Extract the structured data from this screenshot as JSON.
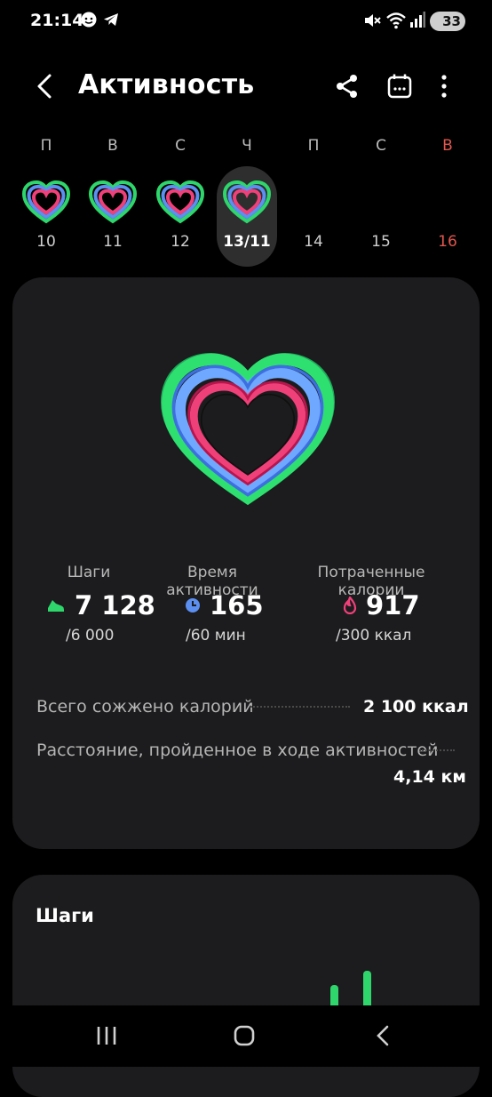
{
  "status_bar": {
    "time": "21:14",
    "battery": "33"
  },
  "header": {
    "title": "Активность"
  },
  "week": {
    "days": [
      {
        "letter": "П",
        "num": "10",
        "has_ring": true,
        "selected": false,
        "weekend": false
      },
      {
        "letter": "В",
        "num": "11",
        "has_ring": true,
        "selected": false,
        "weekend": false
      },
      {
        "letter": "С",
        "num": "12",
        "has_ring": true,
        "selected": false,
        "weekend": false
      },
      {
        "letter": "Ч",
        "num": "13/11",
        "has_ring": true,
        "selected": true,
        "weekend": false
      },
      {
        "letter": "П",
        "num": "14",
        "has_ring": false,
        "selected": false,
        "weekend": false
      },
      {
        "letter": "С",
        "num": "15",
        "has_ring": false,
        "selected": false,
        "weekend": false
      },
      {
        "letter": "В",
        "num": "16",
        "has_ring": false,
        "selected": false,
        "weekend": true
      }
    ]
  },
  "summary": {
    "steps": {
      "label": "Шаги",
      "value": "7 128",
      "goal": "/6 000"
    },
    "active_time": {
      "label": "Время активности",
      "value": "165",
      "goal": "/60 мин"
    },
    "calories": {
      "label": "Потраченные калории",
      "value": "917",
      "goal": "/300 ккал"
    },
    "total_burned": {
      "label": "Всего сожжено калорий",
      "value": "2 100 ккал"
    },
    "distance": {
      "label": "Расстояние, пройденное в ходе активностей",
      "value": "4,14 км"
    }
  },
  "steps_card": {
    "title": "Шаги"
  },
  "colors": {
    "green": "#2ed66b",
    "blue": "#5b8ff0",
    "pink": "#f0407a",
    "weekend_red": "#e0574f"
  }
}
